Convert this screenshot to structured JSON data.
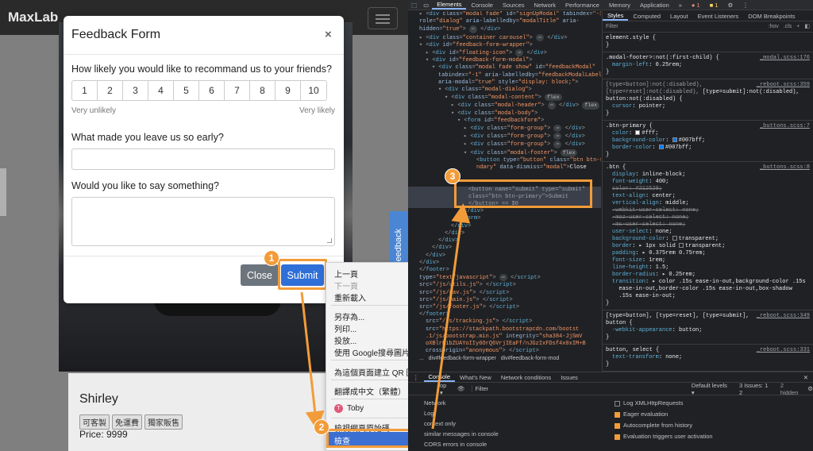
{
  "site": {
    "brand": "MaxLab",
    "product_name": "Shirley",
    "tags": [
      "可客製",
      "免運費",
      "獨家販售"
    ],
    "price": "Price: 9999",
    "feedback_tab": "Feedback"
  },
  "modal": {
    "title": "Feedback Form",
    "close_icon": "×",
    "q1": "How likely you would like to recommand us to your friends?",
    "ratings": [
      "1",
      "2",
      "3",
      "4",
      "5",
      "6",
      "7",
      "8",
      "9",
      "10"
    ],
    "very_unlikely": "Very unlikely",
    "very_likely": "Very likely",
    "q2": "What made you leave us so early?",
    "q3": "Would you like to say something?",
    "close_btn": "Close",
    "submit_btn": "Submit"
  },
  "context_menu": {
    "back": "上一頁",
    "forward": "下一頁",
    "reload": "重新載入",
    "save_as": "另存為...",
    "print": "列印...",
    "cast": "投放...",
    "google_search": "使用 Google搜尋圖片",
    "qr": "為這個頁面建立 QR 圖碼",
    "translate": "翻譯成中文（繁體）",
    "toby": "Toby",
    "view_source": "檢視網頁原始碼",
    "inspect": "檢查"
  },
  "badges": [
    "1",
    "2",
    "3"
  ],
  "devtools": {
    "tabs": [
      "Elements",
      "Console",
      "Sources",
      "Network",
      "Performance",
      "Memory",
      "Application",
      "Security"
    ],
    "issue_count_a": "1",
    "issue_count_b": "1",
    "styles_tabs": [
      "Styles",
      "Computed",
      "Layout",
      "Event Listeners",
      "DOM Breakpoints"
    ],
    "filter_placeholder": "Filter",
    "hov": ":hov",
    "cls": ".cls",
    "selected_button_line1": "<button name=\"submit\" type=\"submit\"",
    "selected_button_line2": "class=\"btn btn-primary\">Submit",
    "selected_button_line3": "</button> == $0",
    "drawer_tabs": [
      "Console",
      "What's New",
      "Network conditions",
      "Issues"
    ],
    "drawer_filter": "Filter",
    "default_levels": "Default levels ▾",
    "issues_summary": "3 Issues: 1 2",
    "hidden": "2 hidden",
    "console_opts_left": [
      "Network",
      "Log",
      "context only",
      "similar messages in console",
      "CORS errors in console"
    ],
    "console_opts_right": [
      {
        "label": "Log XMLHttpRequests",
        "checked": false
      },
      {
        "label": "Eager evaluation",
        "checked": true
      },
      {
        "label": "Autocomplete from history",
        "checked": true
      },
      {
        "label": "Evaluation triggers user activation",
        "checked": true
      }
    ],
    "colors": {
      "accent": "#f29c39",
      "btn_primary": "#007bff"
    }
  }
}
